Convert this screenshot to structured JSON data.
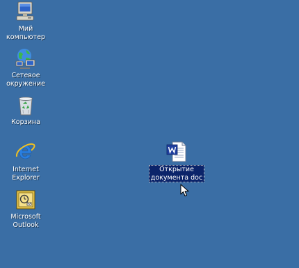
{
  "desktop": {
    "background_color": "#3a6ea5",
    "icons": [
      {
        "label": "Мий\nкомпьютер",
        "icon": "my-computer-icon"
      },
      {
        "label": "Сетевое\nокружение",
        "icon": "network-places-icon"
      },
      {
        "label": "Корзина",
        "icon": "recycle-bin-icon"
      },
      {
        "label": "Internet\nExplorer",
        "icon": "internet-explorer-icon"
      },
      {
        "label": "Microsoft\nOutlook",
        "icon": "outlook-icon"
      },
      {
        "label": "Открытие\nдокумента doc",
        "icon": "word-document-icon",
        "selected": true
      }
    ]
  }
}
